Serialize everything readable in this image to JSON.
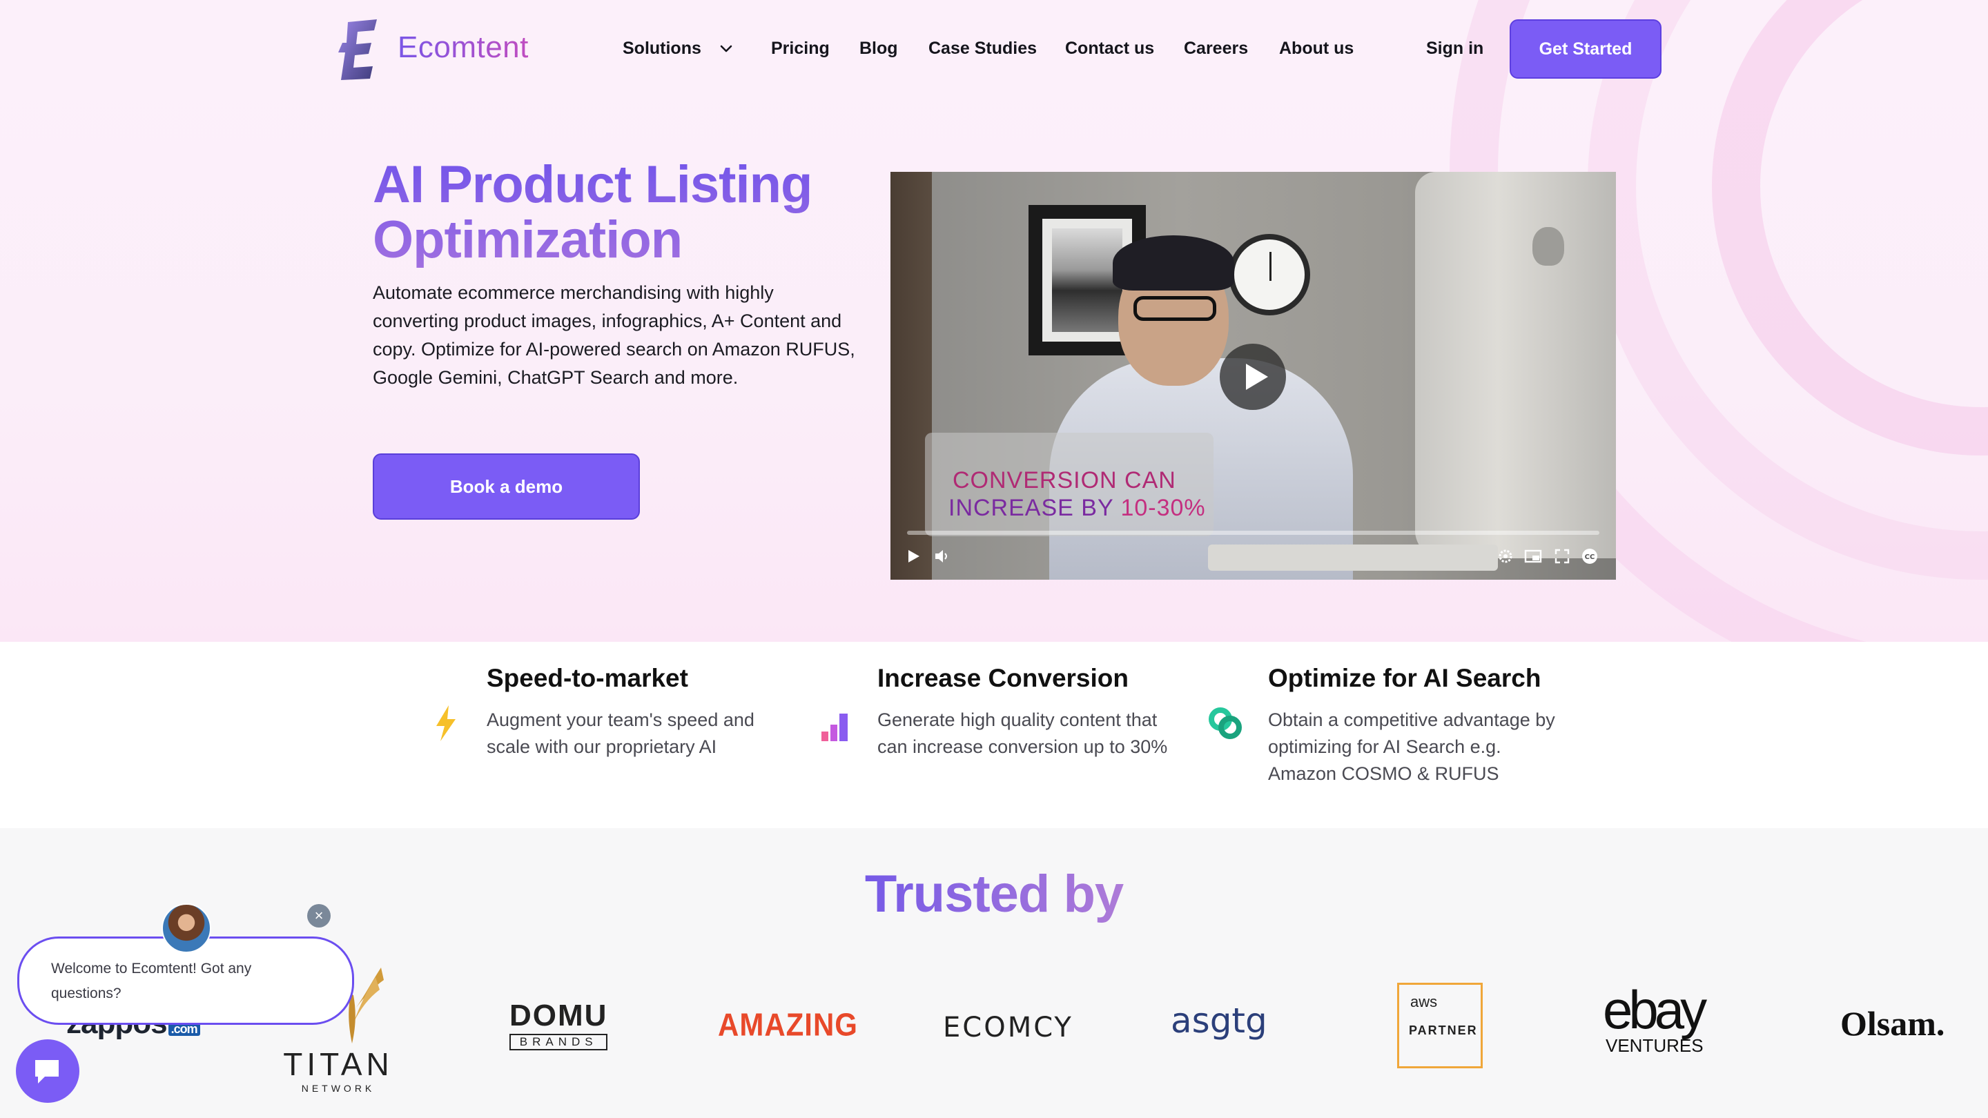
{
  "colors": {
    "accent": "#7b5cf5",
    "title_gradient_start": "#7355ea",
    "title_gradient_end": "#a06fe0"
  },
  "header": {
    "logo_text": "Ecomtent",
    "nav": [
      {
        "label": "Solutions",
        "icon": "chevron-down-icon"
      },
      {
        "label": "Pricing"
      },
      {
        "label": "Blog"
      },
      {
        "label": "Case Studies"
      },
      {
        "label": "Contact us"
      },
      {
        "label": "Careers"
      },
      {
        "label": "About us"
      }
    ],
    "sign_in": "Sign in",
    "get_started": "Get Started"
  },
  "hero": {
    "title": "AI Product Listing Optimization",
    "description": "Automate ecommerce merchandising with highly converting product images, infographics, A+ Content and copy. Optimize for AI-powered search on Amazon RUFUS, Google Gemini, ChatGPT Search and more.",
    "cta": "Book a demo"
  },
  "video": {
    "caption_line1": "CONVERSION CAN",
    "caption_line2_prefix": "INCREASE BY",
    "caption_line2_highlight": "10-30%",
    "controls": [
      "play-icon",
      "volume-icon",
      "settings-icon",
      "picture-in-picture-icon",
      "fullscreen-icon",
      "captions-icon"
    ]
  },
  "features": [
    {
      "title": "Speed-to-market",
      "description": "Augment your team's speed and scale with our proprietary AI",
      "icon": "lightning-icon"
    },
    {
      "title": "Increase Conversion",
      "description": "Generate high quality content that can increase conversion up to 30%",
      "icon": "bar-chart-icon"
    },
    {
      "title": "Optimize for AI Search",
      "description": "Obtain a competitive advantage by optimizing for AI Search e.g. Amazon COSMO & RUFUS",
      "icon": "knot-icon"
    }
  ],
  "trusted": {
    "title": "Trusted by",
    "logos": {
      "zappos": "zappos",
      "zappos_sub": ".com",
      "titan": "TITAN",
      "titan_sub": "NETWORK",
      "domu": "DOMU",
      "domu_sub": "BRANDS",
      "amazing": "AMAZING",
      "ecomcy": "ECOMCY",
      "asgtg": "asgtg",
      "aws": "aws",
      "aws_sub": "PARTNER",
      "ebay": "ebay",
      "ebay_sub": "VENTURES",
      "olsam": "Olsam."
    }
  },
  "chat": {
    "message": "Welcome to Ecomtent! Got any questions?"
  }
}
